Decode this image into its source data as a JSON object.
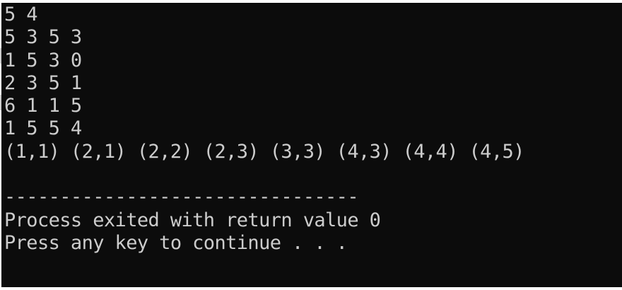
{
  "console": {
    "lines": [
      "5 4",
      "5 3 5 3",
      "1 5 3 0",
      "2 3 5 1",
      "6 1 1 5",
      "1 5 5 4",
      "(1,1) (2,1) (2,2) (2,3) (3,3) (4,3) (4,4) (4,5)",
      "",
      "--------------------------------",
      "Process exited with return value 0",
      "Press any key to continue . . ."
    ]
  },
  "colors": {
    "background": "#0c0c0c",
    "foreground": "#cccccc"
  }
}
